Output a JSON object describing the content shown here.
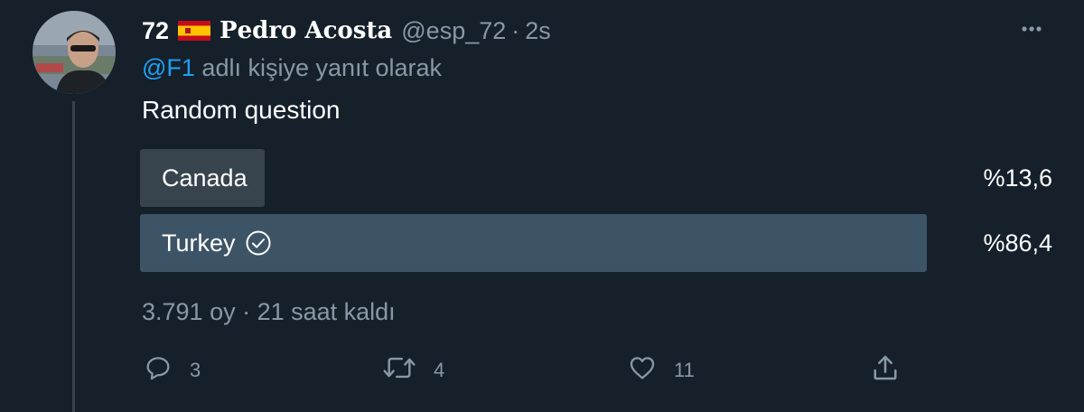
{
  "tweet": {
    "display_name_prefix": "72",
    "display_name": "𝐏𝐞𝐝𝐫𝐨 𝐀𝐜𝐨𝐬𝐭𝐚",
    "handle": "@esp_72",
    "separator": "·",
    "timestamp": "2s",
    "reply_to_mention": "@F1",
    "reply_to_suffix": " adlı kişiye yanıt olarak",
    "text": "Random question",
    "icons": {
      "flag": "spain-flag-icon",
      "more": "more-horizontal-icon",
      "check": "check-circle-icon"
    }
  },
  "poll": {
    "options": [
      {
        "label": "Canada",
        "percent_text": "%13,6",
        "percent": 13.6,
        "selected": false
      },
      {
        "label": "Turkey",
        "percent_text": "%86,4",
        "percent": 86.4,
        "selected": true
      }
    ],
    "meta": "3.791 oy · 21 saat kaldı"
  },
  "actions": {
    "reply": {
      "icon": "reply-icon",
      "count": "3"
    },
    "retweet": {
      "icon": "retweet-icon",
      "count": "4"
    },
    "like": {
      "icon": "heart-icon",
      "count": "11"
    },
    "share": {
      "icon": "share-icon"
    }
  },
  "colors": {
    "background": "#15202b",
    "secondary_text": "#8899a6",
    "link": "#1da1f2",
    "poll_winner": "#3d5466",
    "poll_other": "#38444d"
  }
}
